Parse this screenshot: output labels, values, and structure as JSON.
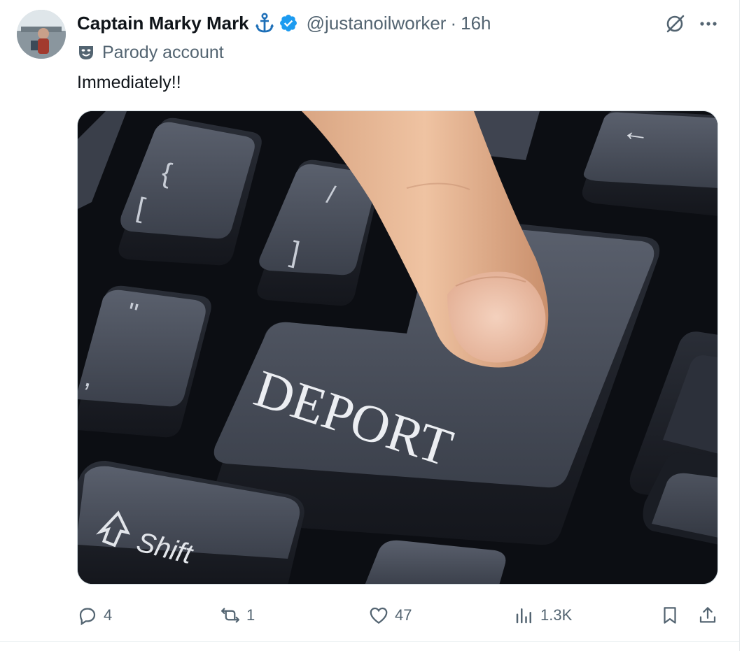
{
  "author": {
    "display_name": "Captain Marky Mark",
    "handle": "@justanoilworker",
    "separator": "·",
    "time": "16h",
    "label": "Parody account"
  },
  "tweet": {
    "text": "Immediately!!"
  },
  "image_text": {
    "main_key": "DEPORT",
    "shift_key": "Shift",
    "left_bracket_top": "{",
    "left_bracket_bottom": "[",
    "right_bracket": "]",
    "quote_key_top": "\"",
    "backspace_arrow": "←"
  },
  "actions": {
    "replies": "4",
    "reposts": "1",
    "likes": "47",
    "views": "1.3K"
  },
  "icons": {
    "reply": "speech-bubble-icon",
    "repost": "repost-arrows-icon",
    "like": "heart-icon",
    "views": "bar-chart-icon",
    "bookmark": "bookmark-icon",
    "share": "upload-arrow-icon",
    "verified": "verified-badge-icon",
    "anchor": "anchor-icon",
    "grok": "grok-slash-icon",
    "more": "more-dots-icon",
    "parody": "theater-mask-icon"
  },
  "colors": {
    "text_primary": "#0f1419",
    "text_secondary": "#536471",
    "verified": "#1d9bf0",
    "anchor": "#1d6fb8"
  }
}
